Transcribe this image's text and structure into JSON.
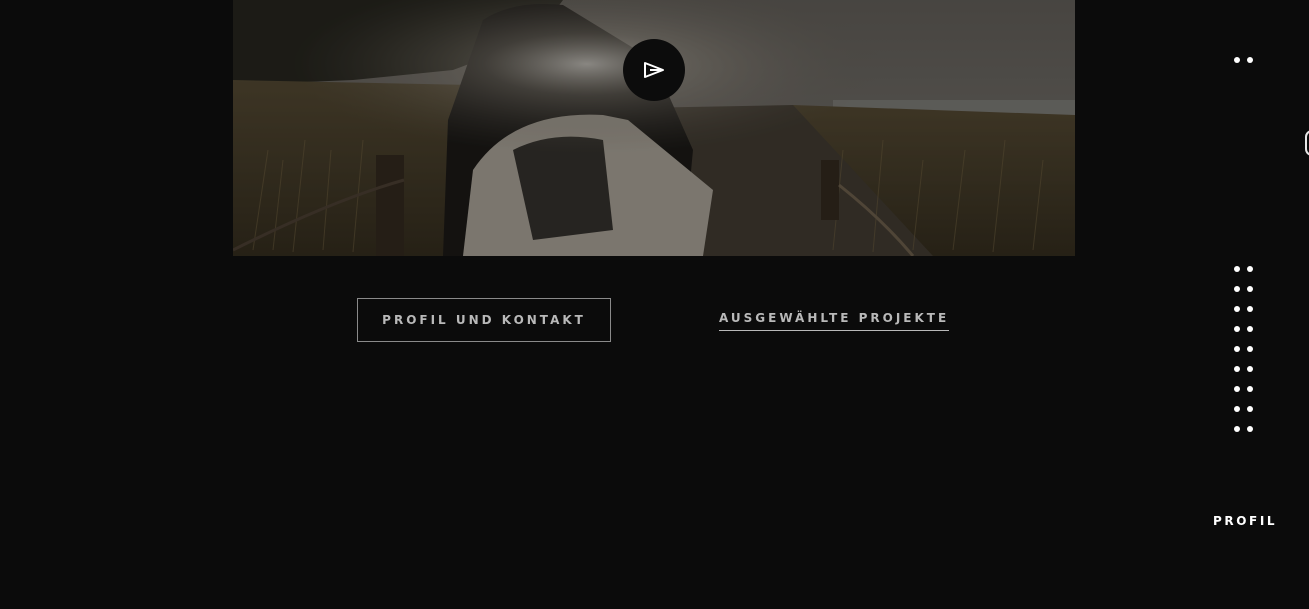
{
  "hero": {
    "play_icon": "play-icon"
  },
  "cta": {
    "profile_contact_label": "PROFIL UND KONTAKT",
    "projects_label": "AUSGEWÄHLTE PROJEKTE"
  },
  "side_nav": {
    "menu_icon": "menu-dots-icon",
    "section_count": 9,
    "current_section_label": "PROFIL"
  },
  "colors": {
    "background": "#0b0b0b",
    "text": "#b9b9b9",
    "accent": "#ffffff"
  }
}
